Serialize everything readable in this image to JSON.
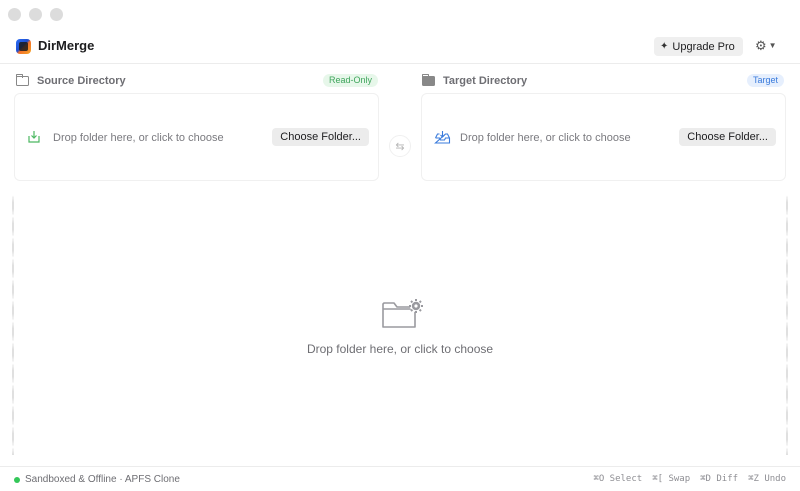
{
  "app": {
    "title": "DirMerge"
  },
  "header": {
    "upgrade_label": "Upgrade Pro",
    "settings_icon": "gear-icon"
  },
  "source": {
    "label": "Source Directory",
    "badge": "Read-Only",
    "drop_text": "Drop folder here, or click to choose",
    "button": "Choose Folder..."
  },
  "target": {
    "label": "Target Directory",
    "badge": "Target",
    "drop_text": "Drop folder here, or click to choose",
    "button": "Choose Folder..."
  },
  "empty_state": {
    "text": "Drop folder here, or click to choose"
  },
  "footer": {
    "status": "Sandboxed & Offline · APFS Clone",
    "shortcuts": [
      "⌘O Select",
      "⌘[ Swap",
      "⌘D Diff",
      "⌘Z Undo"
    ]
  },
  "colors": {
    "status_ok": "#34c759",
    "readonly_badge": "#3fa55c",
    "target_badge": "#3a7bdc"
  }
}
